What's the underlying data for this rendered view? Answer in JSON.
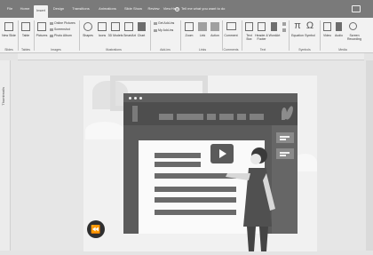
{
  "tabs": [
    {
      "label": "File",
      "active": false
    },
    {
      "label": "Home",
      "active": false
    },
    {
      "label": "Insert",
      "active": true
    },
    {
      "label": "Design",
      "active": false
    },
    {
      "label": "Transitions",
      "active": false
    },
    {
      "label": "Animations",
      "active": false
    },
    {
      "label": "Slide Show",
      "active": false
    },
    {
      "label": "Review",
      "active": false
    },
    {
      "label": "View",
      "active": false
    },
    {
      "label": "Help",
      "active": false
    }
  ],
  "tell_me": "Tell me what you want to do",
  "ribbon": {
    "new_slide": "New Slide",
    "table": "Table",
    "pictures": "Pictures",
    "online_pictures": "Online Pictures",
    "screenshot": "Screenshot",
    "photo_album": "Photo Album",
    "shapes": "Shapes",
    "icons": "Icons",
    "models_3d": "3D Models",
    "smartart": "SmartArt",
    "chart": "Chart",
    "get_addins": "Get Add-ins",
    "my_addins": "My Add-ins",
    "zoom": "Zoom",
    "link": "Link",
    "action": "Action",
    "comment": "Comment",
    "text_box": "Text Box",
    "header_footer": "Header & Footer",
    "wordart": "WordArt",
    "equation": "Equation",
    "symbol": "Symbol",
    "video": "Video",
    "audio": "Audio",
    "screen_recording": "Screen Recording"
  },
  "groups": {
    "slides": "Slides",
    "tables": "Tables",
    "images": "Images",
    "illustrations": "Illustrations",
    "addins": "Add-ins",
    "links": "Links",
    "comments": "Comments",
    "text": "Text",
    "symbols": "Symbols",
    "media": "Media"
  },
  "side_label": "Thumbnails",
  "icons": {
    "share": "share-icon",
    "search": "search-icon",
    "play": "play-icon",
    "rewind": "rewind-icon"
  },
  "colors": {
    "tab_bar": "#7a7a7a",
    "ribbon": "#f2f2f2",
    "monitor": "#5b5b5b"
  }
}
